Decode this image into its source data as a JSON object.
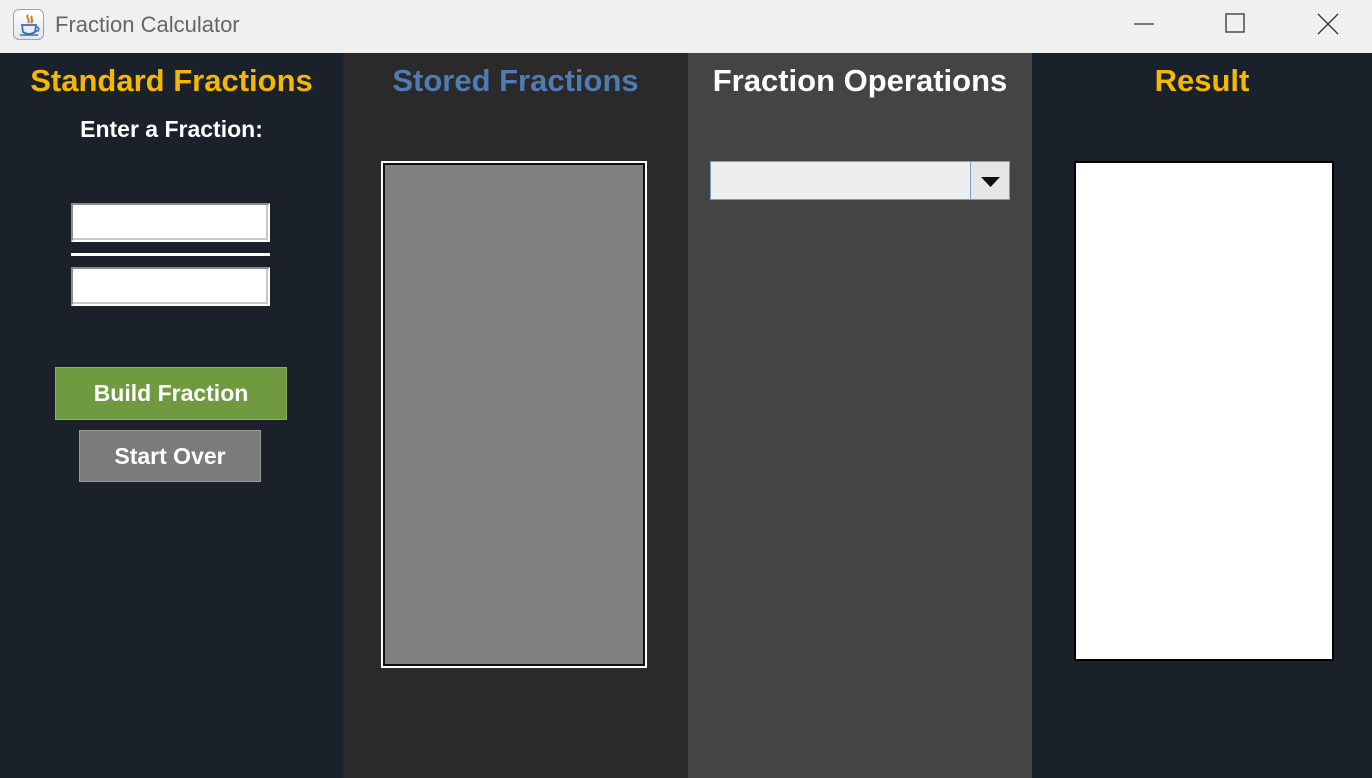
{
  "window": {
    "title": "Fraction Calculator",
    "icon": "java-cup-icon",
    "controls": [
      "minimize-icon",
      "maximize-icon",
      "close-icon"
    ]
  },
  "standard": {
    "heading": "Standard Fractions",
    "heading_color": "#f5b800",
    "prompt": "Enter a Fraction:",
    "numerator_value": "",
    "denominator_value": "",
    "build_label": "Build Fraction",
    "build_color": "#6f9a3f",
    "start_over_label": "Start Over",
    "start_over_color": "#7b7b7b"
  },
  "stored": {
    "heading": "Stored Fractions",
    "heading_color": "#4f7bb5",
    "items": []
  },
  "operations": {
    "heading": "Fraction Operations",
    "heading_color": "#ffffff",
    "selected": ""
  },
  "result": {
    "heading": "Result",
    "heading_color": "#f5b800",
    "value": ""
  }
}
